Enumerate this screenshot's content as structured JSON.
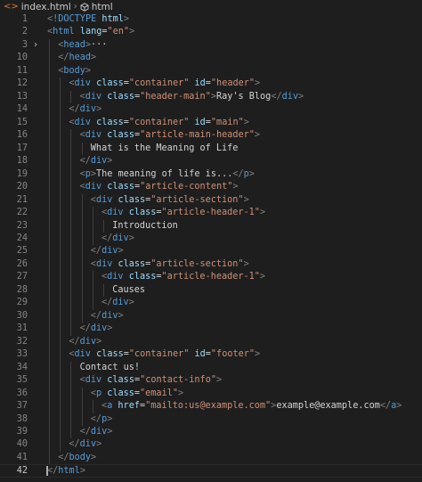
{
  "breadcrumb": {
    "file": "index.html",
    "node": "html",
    "file_icon": "code-file-icon",
    "node_icon": "cube-icon",
    "chevron": "›"
  },
  "editor": {
    "current_line": 42,
    "lines": [
      {
        "n": "1",
        "indent": 0,
        "tokens": [
          [
            "p",
            "<"
          ],
          [
            "d",
            "!DOCTYPE"
          ],
          [
            "x",
            " "
          ],
          [
            "a",
            "html"
          ],
          [
            "p",
            ">"
          ]
        ]
      },
      {
        "n": "2",
        "indent": 0,
        "tokens": [
          [
            "p",
            "<"
          ],
          [
            "t",
            "html"
          ],
          [
            "x",
            " "
          ],
          [
            "a",
            "lang"
          ],
          [
            "x",
            "="
          ],
          [
            "s",
            "\"en\""
          ],
          [
            "p",
            ">"
          ]
        ]
      },
      {
        "n": "3",
        "indent": 1,
        "fold": true,
        "tokens": [
          [
            "p",
            "<"
          ],
          [
            "t",
            "head"
          ],
          [
            "p",
            ">"
          ],
          [
            "x",
            "···"
          ]
        ]
      },
      {
        "n": "10",
        "indent": 1,
        "tokens": [
          [
            "p",
            "</"
          ],
          [
            "t",
            "head"
          ],
          [
            "p",
            ">"
          ]
        ]
      },
      {
        "n": "11",
        "indent": 1,
        "tokens": [
          [
            "p",
            "<"
          ],
          [
            "t",
            "body"
          ],
          [
            "p",
            ">"
          ]
        ]
      },
      {
        "n": "12",
        "indent": 2,
        "tokens": [
          [
            "p",
            "<"
          ],
          [
            "t",
            "div"
          ],
          [
            "x",
            " "
          ],
          [
            "a",
            "class"
          ],
          [
            "x",
            "="
          ],
          [
            "s",
            "\"container\""
          ],
          [
            "x",
            " "
          ],
          [
            "a",
            "id"
          ],
          [
            "x",
            "="
          ],
          [
            "s",
            "\"header\""
          ],
          [
            "p",
            ">"
          ]
        ]
      },
      {
        "n": "13",
        "indent": 3,
        "tokens": [
          [
            "p",
            "<"
          ],
          [
            "t",
            "div"
          ],
          [
            "x",
            " "
          ],
          [
            "a",
            "class"
          ],
          [
            "x",
            "="
          ],
          [
            "s",
            "\"header-main\""
          ],
          [
            "p",
            ">"
          ],
          [
            "x",
            "Ray's Blog"
          ],
          [
            "p",
            "</"
          ],
          [
            "t",
            "div"
          ],
          [
            "p",
            ">"
          ]
        ]
      },
      {
        "n": "14",
        "indent": 2,
        "tokens": [
          [
            "p",
            "</"
          ],
          [
            "t",
            "div"
          ],
          [
            "p",
            ">"
          ]
        ]
      },
      {
        "n": "15",
        "indent": 2,
        "tokens": [
          [
            "p",
            "<"
          ],
          [
            "t",
            "div"
          ],
          [
            "x",
            " "
          ],
          [
            "a",
            "class"
          ],
          [
            "x",
            "="
          ],
          [
            "s",
            "\"container\""
          ],
          [
            "x",
            " "
          ],
          [
            "a",
            "id"
          ],
          [
            "x",
            "="
          ],
          [
            "s",
            "\"main\""
          ],
          [
            "p",
            ">"
          ]
        ]
      },
      {
        "n": "16",
        "indent": 3,
        "tokens": [
          [
            "p",
            "<"
          ],
          [
            "t",
            "div"
          ],
          [
            "x",
            " "
          ],
          [
            "a",
            "class"
          ],
          [
            "x",
            "="
          ],
          [
            "s",
            "\"article-main-header\""
          ],
          [
            "p",
            ">"
          ]
        ]
      },
      {
        "n": "17",
        "indent": 4,
        "tokens": [
          [
            "x",
            "What is the Meaning of Life"
          ]
        ]
      },
      {
        "n": "18",
        "indent": 3,
        "tokens": [
          [
            "p",
            "</"
          ],
          [
            "t",
            "div"
          ],
          [
            "p",
            ">"
          ]
        ]
      },
      {
        "n": "19",
        "indent": 3,
        "tokens": [
          [
            "p",
            "<"
          ],
          [
            "t",
            "p"
          ],
          [
            "p",
            ">"
          ],
          [
            "x",
            "The meaning of life is..."
          ],
          [
            "p",
            "</"
          ],
          [
            "t",
            "p"
          ],
          [
            "p",
            ">"
          ]
        ]
      },
      {
        "n": "20",
        "indent": 3,
        "tokens": [
          [
            "p",
            "<"
          ],
          [
            "t",
            "div"
          ],
          [
            "x",
            " "
          ],
          [
            "a",
            "class"
          ],
          [
            "x",
            "="
          ],
          [
            "s",
            "\"article-content\""
          ],
          [
            "p",
            ">"
          ]
        ]
      },
      {
        "n": "21",
        "indent": 4,
        "tokens": [
          [
            "p",
            "<"
          ],
          [
            "t",
            "div"
          ],
          [
            "x",
            " "
          ],
          [
            "a",
            "class"
          ],
          [
            "x",
            "="
          ],
          [
            "s",
            "\"article-section\""
          ],
          [
            "p",
            ">"
          ]
        ]
      },
      {
        "n": "22",
        "indent": 5,
        "tokens": [
          [
            "p",
            "<"
          ],
          [
            "t",
            "div"
          ],
          [
            "x",
            " "
          ],
          [
            "a",
            "class"
          ],
          [
            "x",
            "="
          ],
          [
            "s",
            "\"article-header-1\""
          ],
          [
            "p",
            ">"
          ]
        ]
      },
      {
        "n": "23",
        "indent": 6,
        "tokens": [
          [
            "x",
            "Introduction"
          ]
        ]
      },
      {
        "n": "24",
        "indent": 5,
        "tokens": [
          [
            "p",
            "</"
          ],
          [
            "t",
            "div"
          ],
          [
            "p",
            ">"
          ]
        ]
      },
      {
        "n": "25",
        "indent": 4,
        "tokens": [
          [
            "p",
            "</"
          ],
          [
            "t",
            "div"
          ],
          [
            "p",
            ">"
          ]
        ]
      },
      {
        "n": "26",
        "indent": 4,
        "tokens": [
          [
            "p",
            "<"
          ],
          [
            "t",
            "div"
          ],
          [
            "x",
            " "
          ],
          [
            "a",
            "class"
          ],
          [
            "x",
            "="
          ],
          [
            "s",
            "\"article-section\""
          ],
          [
            "p",
            ">"
          ]
        ]
      },
      {
        "n": "27",
        "indent": 5,
        "tokens": [
          [
            "p",
            "<"
          ],
          [
            "t",
            "div"
          ],
          [
            "x",
            " "
          ],
          [
            "a",
            "class"
          ],
          [
            "x",
            "="
          ],
          [
            "s",
            "\"article-header-1\""
          ],
          [
            "p",
            ">"
          ]
        ]
      },
      {
        "n": "28",
        "indent": 6,
        "tokens": [
          [
            "x",
            "Causes"
          ]
        ]
      },
      {
        "n": "29",
        "indent": 5,
        "tokens": [
          [
            "p",
            "</"
          ],
          [
            "t",
            "div"
          ],
          [
            "p",
            ">"
          ]
        ]
      },
      {
        "n": "30",
        "indent": 4,
        "tokens": [
          [
            "p",
            "</"
          ],
          [
            "t",
            "div"
          ],
          [
            "p",
            ">"
          ]
        ]
      },
      {
        "n": "31",
        "indent": 3,
        "tokens": [
          [
            "p",
            "</"
          ],
          [
            "t",
            "div"
          ],
          [
            "p",
            ">"
          ]
        ]
      },
      {
        "n": "32",
        "indent": 2,
        "tokens": [
          [
            "p",
            "</"
          ],
          [
            "t",
            "div"
          ],
          [
            "p",
            ">"
          ]
        ]
      },
      {
        "n": "33",
        "indent": 2,
        "tokens": [
          [
            "p",
            "<"
          ],
          [
            "t",
            "div"
          ],
          [
            "x",
            " "
          ],
          [
            "a",
            "class"
          ],
          [
            "x",
            "="
          ],
          [
            "s",
            "\"container\""
          ],
          [
            "x",
            " "
          ],
          [
            "a",
            "id"
          ],
          [
            "x",
            "="
          ],
          [
            "s",
            "\"footer\""
          ],
          [
            "p",
            ">"
          ]
        ]
      },
      {
        "n": "34",
        "indent": 3,
        "tokens": [
          [
            "x",
            "Contact us!"
          ]
        ]
      },
      {
        "n": "35",
        "indent": 3,
        "tokens": [
          [
            "p",
            "<"
          ],
          [
            "t",
            "div"
          ],
          [
            "x",
            " "
          ],
          [
            "a",
            "class"
          ],
          [
            "x",
            "="
          ],
          [
            "s",
            "\"contact-info\""
          ],
          [
            "p",
            ">"
          ]
        ]
      },
      {
        "n": "36",
        "indent": 4,
        "tokens": [
          [
            "p",
            "<"
          ],
          [
            "t",
            "p"
          ],
          [
            "x",
            " "
          ],
          [
            "a",
            "class"
          ],
          [
            "x",
            "="
          ],
          [
            "s",
            "\"email\""
          ],
          [
            "p",
            ">"
          ]
        ]
      },
      {
        "n": "37",
        "indent": 5,
        "tokens": [
          [
            "p",
            "<"
          ],
          [
            "t",
            "a"
          ],
          [
            "x",
            " "
          ],
          [
            "a",
            "href"
          ],
          [
            "x",
            "="
          ],
          [
            "s",
            "\"mailto:us@example.com\""
          ],
          [
            "p",
            ">"
          ],
          [
            "x",
            "example@example.com"
          ],
          [
            "p",
            "</"
          ],
          [
            "t",
            "a"
          ],
          [
            "p",
            ">"
          ]
        ]
      },
      {
        "n": "38",
        "indent": 4,
        "tokens": [
          [
            "p",
            "</"
          ],
          [
            "t",
            "p"
          ],
          [
            "p",
            ">"
          ]
        ]
      },
      {
        "n": "39",
        "indent": 3,
        "tokens": [
          [
            "p",
            "</"
          ],
          [
            "t",
            "div"
          ],
          [
            "p",
            ">"
          ]
        ]
      },
      {
        "n": "40",
        "indent": 2,
        "tokens": [
          [
            "p",
            "</"
          ],
          [
            "t",
            "div"
          ],
          [
            "p",
            ">"
          ]
        ]
      },
      {
        "n": "41",
        "indent": 1,
        "tokens": [
          [
            "p",
            "</"
          ],
          [
            "t",
            "body"
          ],
          [
            "p",
            ">"
          ]
        ]
      },
      {
        "n": "42",
        "indent": 0,
        "tokens": [
          [
            "p",
            "</"
          ],
          [
            "t",
            "html"
          ],
          [
            "p",
            ">"
          ]
        ]
      }
    ]
  }
}
